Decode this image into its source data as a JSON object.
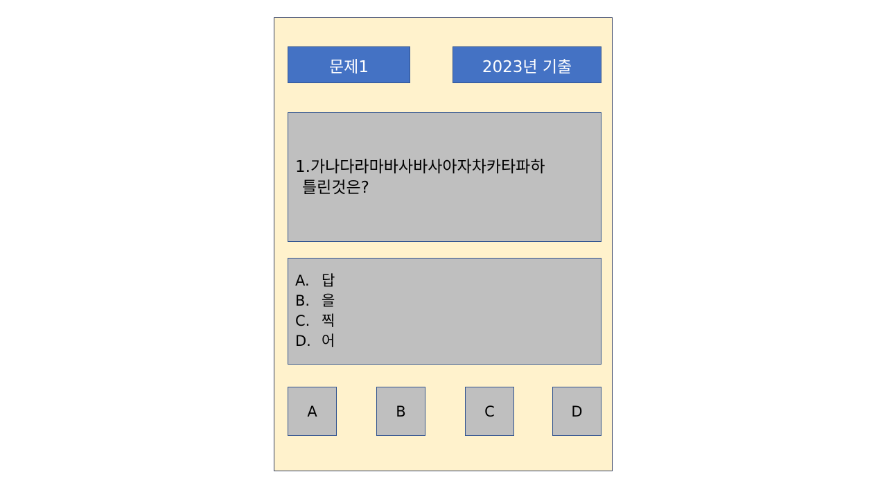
{
  "header": {
    "problem_label": "문제1",
    "exam_label": "2023년 기출"
  },
  "question": {
    "line1": "1.가나다라마바사바사아자차카타파하",
    "line2": "틀린것은?"
  },
  "options": [
    {
      "letter": "A.",
      "text": "답"
    },
    {
      "letter": "B.",
      "text": "을"
    },
    {
      "letter": "C.",
      "text": "찍"
    },
    {
      "letter": "D.",
      "text": "어"
    }
  ],
  "answer_buttons": [
    "A",
    "B",
    "C",
    "D"
  ],
  "colors": {
    "panel_bg": "#fff2cc",
    "tag_bg": "#4472c4",
    "box_bg": "#bfbfbf"
  }
}
